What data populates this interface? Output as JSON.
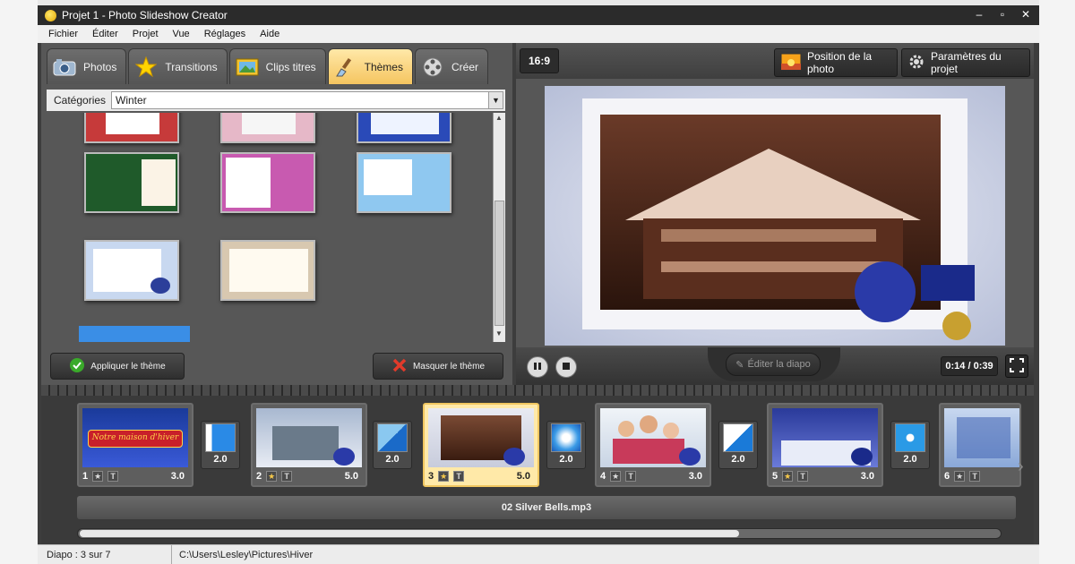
{
  "window": {
    "title": "Projet 1 - Photo Slideshow Creator"
  },
  "menu": [
    "Fichier",
    "Éditer",
    "Projet",
    "Vue",
    "Réglages",
    "Aide"
  ],
  "tabs": [
    {
      "label": "Photos",
      "icon": "camera-icon",
      "active": false
    },
    {
      "label": "Transitions",
      "icon": "star-icon",
      "active": false
    },
    {
      "label": "Clips titres",
      "icon": "picture-icon",
      "active": false
    },
    {
      "label": "Thèmes",
      "icon": "brush-icon",
      "active": true
    },
    {
      "label": "Créer",
      "icon": "film-reel-icon",
      "active": false
    }
  ],
  "categories": {
    "label": "Catégories",
    "value": "Winter"
  },
  "theme_actions": {
    "apply": "Appliquer le thème",
    "hide": "Masquer le thème"
  },
  "preview": {
    "ratio": "16:9",
    "photo_position": "Position de la photo",
    "project_settings": "Paramètres du projet",
    "edit_slide": "Éditer la diapo",
    "time": "0:14 / 0:39"
  },
  "timeline": {
    "slides": [
      {
        "num": "1",
        "dur": "3.0",
        "caption": "Notre maison d'hiver"
      },
      {
        "num": "2",
        "dur": "5.0"
      },
      {
        "num": "3",
        "dur": "5.0"
      },
      {
        "num": "4",
        "dur": "3.0"
      },
      {
        "num": "5",
        "dur": "3.0"
      },
      {
        "num": "6",
        "dur": ""
      }
    ],
    "transitions": [
      "2.0",
      "2.0",
      "2.0",
      "2.0",
      "2.0"
    ],
    "audio": "02 Silver Bells.mp3"
  },
  "status": {
    "slide": "Diapo : 3 sur 7",
    "path": "C:\\Users\\Lesley\\Pictures\\Hiver"
  },
  "colors": {
    "accent_tab": "#f5c560",
    "selection": "#3a8ee6",
    "panel": "#575757"
  }
}
